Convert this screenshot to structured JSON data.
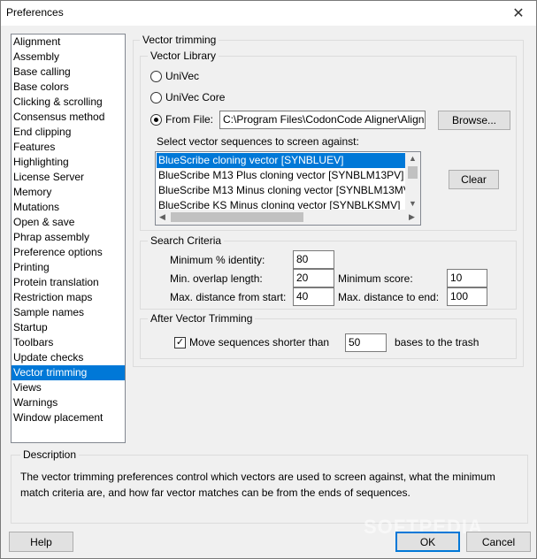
{
  "window": {
    "title": "Preferences",
    "close_glyph": "✕"
  },
  "categories": [
    "Alignment",
    "Assembly",
    "Base calling",
    "Base colors",
    "Clicking & scrolling",
    "Consensus method",
    "End clipping",
    "Features",
    "Highlighting",
    "License Server",
    "Memory",
    "Mutations",
    "Open & save",
    "Phrap assembly",
    "Preference options",
    "Printing",
    "Protein translation",
    "Restriction maps",
    "Sample names",
    "Startup",
    "Toolbars",
    "Update checks",
    "Vector trimming",
    "Views",
    "Warnings",
    "Window placement"
  ],
  "vector_trimming": {
    "group_title": "Vector trimming",
    "library": {
      "title": "Vector Library",
      "univec": "UniVec",
      "univec_core": "UniVec Core",
      "from_file": "From File:",
      "file_path": "C:\\Program Files\\CodonCode Aligner\\Align",
      "browse": "Browse...",
      "select_label": "Select vector sequences to screen against:",
      "vectors": [
        "BlueScribe cloning vector [SYNBLUEV]",
        "BlueScribe M13 Plus cloning vector [SYNBLM13PV]",
        "BlueScribe M13 Minus cloning vector [SYNBLM13MV",
        "BlueScribe KS Minus cloning vector [SYNBLKSMV]"
      ],
      "clear": "Clear"
    },
    "criteria": {
      "title": "Search Criteria",
      "min_identity_label": "Minimum % identity:",
      "min_identity": "80",
      "min_overlap_label": "Min. overlap length:",
      "min_overlap": "20",
      "max_start_label": "Max. distance from start:",
      "max_start": "40",
      "min_score_label": "Minimum score:",
      "min_score": "10",
      "max_end_label": "Max. distance to end:",
      "max_end": "100"
    },
    "after": {
      "title": "After Vector Trimming",
      "move_label": "Move sequences shorter than",
      "move_value": "50",
      "trash_label": "bases to the trash",
      "check_glyph": "✓"
    }
  },
  "description": {
    "title": "Description",
    "text": "The vector trimming preferences control which vectors are used to screen against, what the minimum match criteria are, and how far vector matches can be from the ends of sequences."
  },
  "buttons": {
    "help": "Help",
    "ok": "OK",
    "cancel": "Cancel"
  },
  "watermark": "SOFTPEDIA"
}
